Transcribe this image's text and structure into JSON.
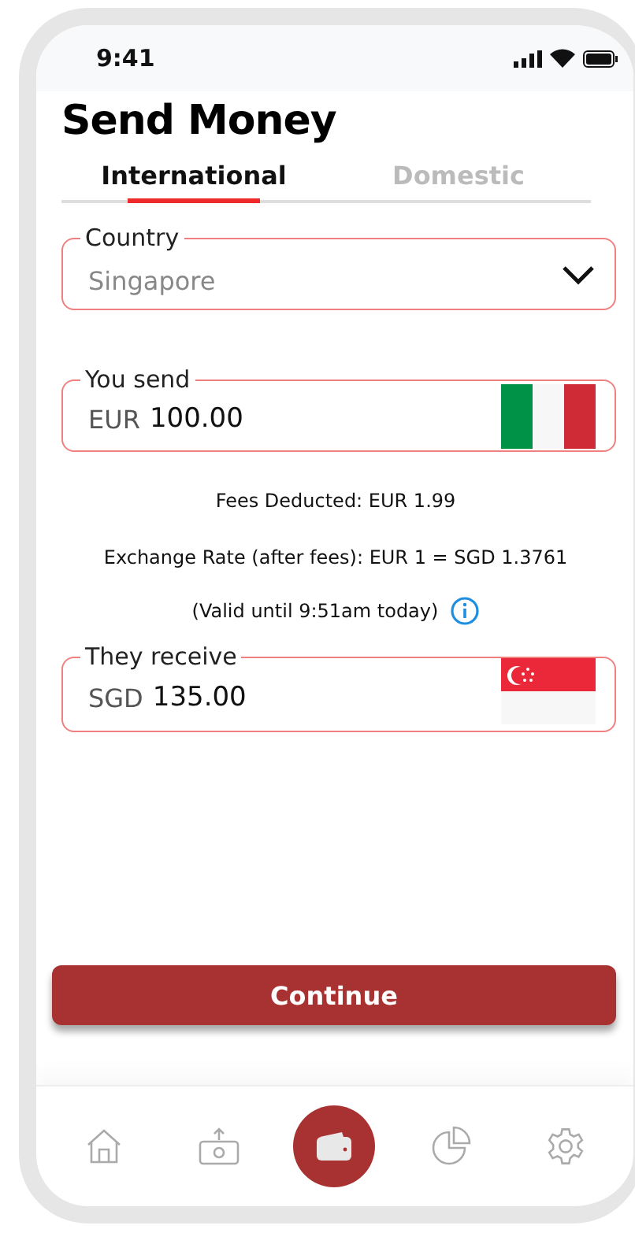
{
  "status_bar": {
    "time": "9:41"
  },
  "title": "Send Money",
  "tabs": [
    {
      "label": "International",
      "selected": true
    },
    {
      "label": "Domestic",
      "selected": false
    }
  ],
  "country": {
    "label": "Country",
    "value": "Singapore"
  },
  "send": {
    "label": "You send",
    "currency": "EUR",
    "amount": "100.00"
  },
  "info": [
    "Fees Deducted: EUR 1.99",
    "Exchange Rate (after fees): EUR 1 = SGD 1.3761",
    "(Valid until 9:51am today)"
  ],
  "receive": {
    "label": "They receive",
    "currency": "SGD",
    "amount": "135.00"
  },
  "continue_button": "Continue",
  "bottom_nav": [
    {
      "kind": "home",
      "selected": false
    },
    {
      "kind": "transfer",
      "selected": false
    },
    {
      "kind": "wallet",
      "selected": true
    },
    {
      "kind": "chart",
      "selected": false
    },
    {
      "kind": "settings",
      "selected": false
    }
  ]
}
